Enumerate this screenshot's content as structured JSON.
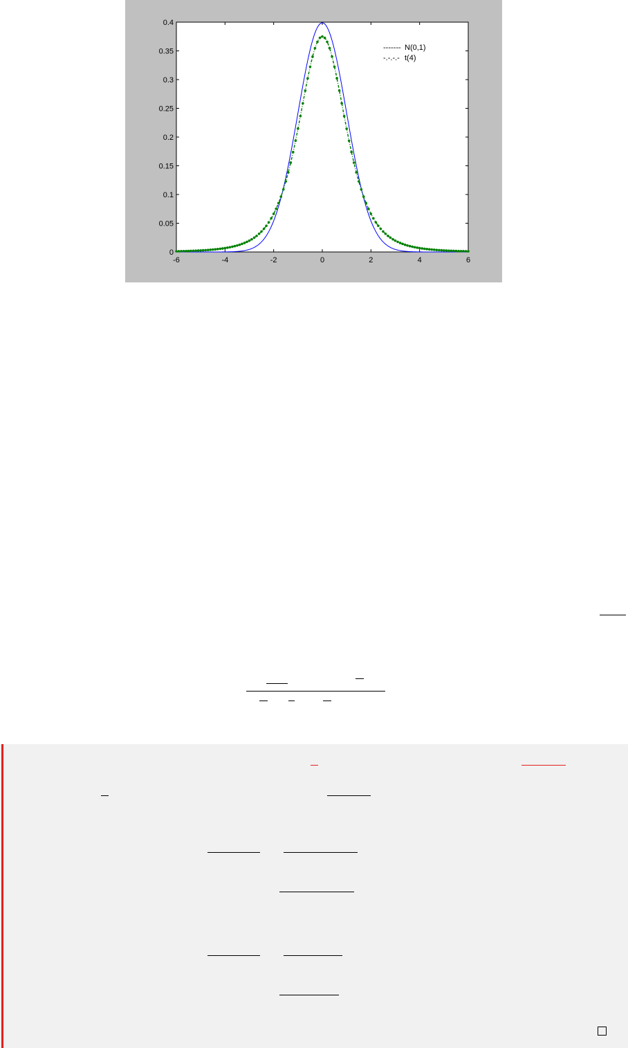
{
  "chart_data": {
    "type": "line",
    "x_ticks": [
      "-6",
      "-4",
      "-2",
      "0",
      "2",
      "4",
      "6"
    ],
    "y_ticks": [
      "0",
      "0.05",
      "0.1",
      "0.15",
      "0.2",
      "0.25",
      "0.3",
      "0.35",
      "0.4"
    ],
    "xlim": [
      -6,
      6
    ],
    "ylim": [
      0,
      0.4
    ],
    "grid": false,
    "legend_position": "top-right",
    "legend": [
      {
        "sample": "-------",
        "label": "N(0,1)"
      },
      {
        "sample": "-.-.-.-",
        "label": "t(4)"
      }
    ],
    "series": [
      {
        "label": "N(0,1)",
        "color": "#0000ff",
        "style": "solid",
        "x": [
          -6,
          -5.5,
          -5,
          -4.5,
          -4,
          -3.5,
          -3,
          -2.5,
          -2,
          -1.5,
          -1,
          -0.5,
          0,
          0.5,
          1,
          1.5,
          2,
          2.5,
          3,
          3.5,
          4,
          4.5,
          5,
          5.5,
          6
        ],
        "y": [
          0.0,
          0.0,
          0.0,
          0.0,
          0.0001,
          0.0009,
          0.0044,
          0.0175,
          0.054,
          0.1295,
          0.242,
          0.3521,
          0.3989,
          0.3521,
          0.242,
          0.1295,
          0.054,
          0.0175,
          0.0044,
          0.0009,
          0.0001,
          0.0,
          0.0,
          0.0,
          0.0
        ]
      },
      {
        "label": "t(4)",
        "color": "#008000",
        "style": "dash-dot-dotted",
        "x": [
          -6,
          -5.5,
          -5,
          -4.5,
          -4,
          -3.5,
          -3,
          -2.5,
          -2,
          -1.5,
          -1,
          -0.5,
          0,
          0.5,
          1,
          1.5,
          2,
          2.5,
          3,
          3.5,
          4,
          4.5,
          5,
          5.5,
          6
        ],
        "y": [
          0.0021,
          0.0029,
          0.0042,
          0.0062,
          0.0092,
          0.0145,
          0.0237,
          0.0405,
          0.0663,
          0.1159,
          0.2147,
          0.32,
          0.375,
          0.32,
          0.2147,
          0.1159,
          0.0663,
          0.0405,
          0.0237,
          0.0145,
          0.0092,
          0.0062,
          0.0042,
          0.0029,
          0.0021
        ]
      }
    ]
  },
  "colors": {
    "figure_background": "#c0c0c0",
    "proof_background": "#f1f1f1",
    "proof_bar": "#e41e1e"
  },
  "proof": {
    "end_marker": "□"
  }
}
